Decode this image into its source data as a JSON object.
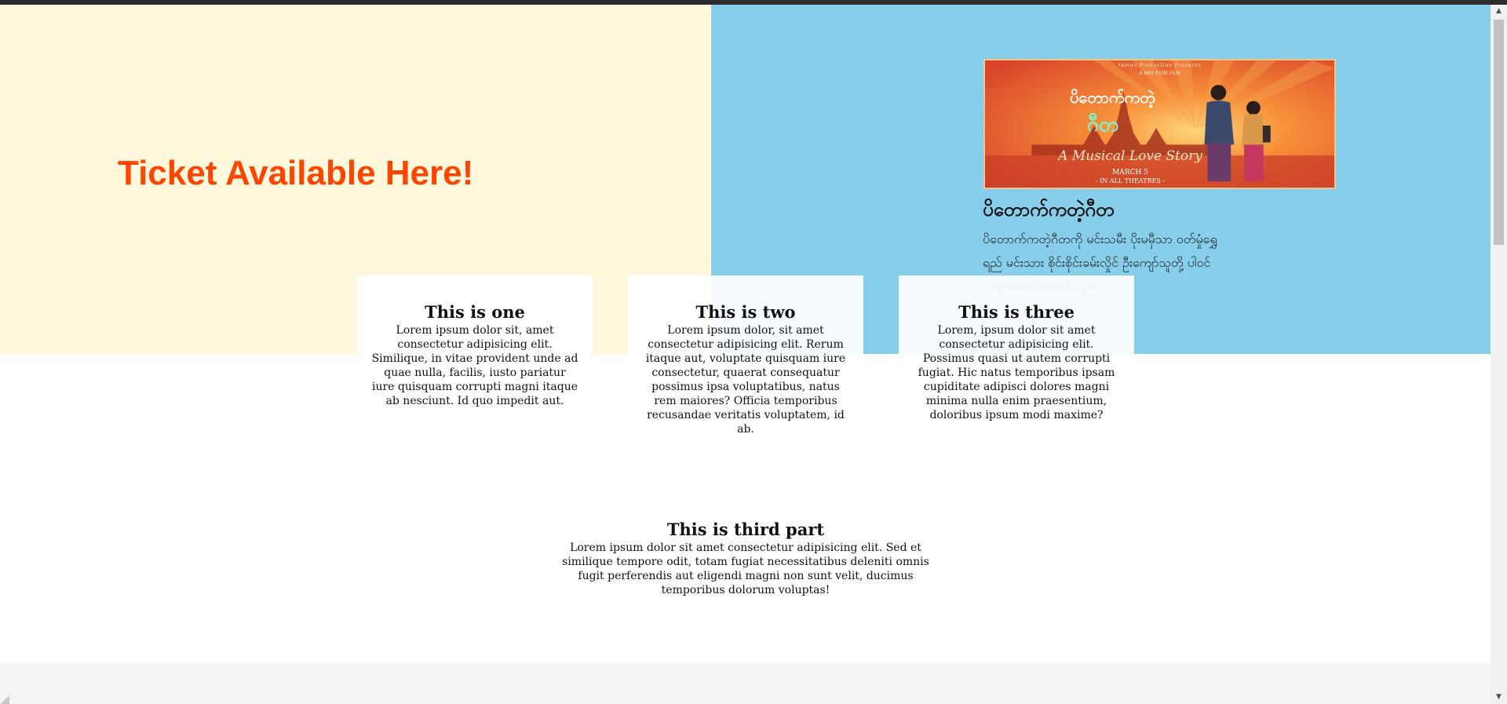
{
  "hero": {
    "title": "Ticket Available Here!"
  },
  "movie": {
    "poster": {
      "top_caption": "Yaman Production Presents",
      "director": "A MEE POSE FILM",
      "logo_line_1": "ပိတောက်ကတဲ့",
      "logo_line_2": "ဂီတ",
      "tagline": "A Musical Love Story",
      "date": "MARCH 5",
      "theatres": "- IN ALL THEATRES -"
    },
    "title": "ပိတောက်ကတဲ့ဂီတ",
    "description": "ပိတောက်ကတဲ့ဂီတကို မင်းသမီး ပိုးမမှီသာ ဝတ်မှုံရွှေရည် မင်းသား စိုင်းစိုင်းခမ်းလှိုင် ဦးကျော်သူတို့ ပါဝင်သရုပ်ဆောင်ထားပါသည်။"
  },
  "cards": [
    {
      "title": "This is one",
      "text": "Lorem ipsum dolor sit, amet consectetur adipisicing elit. Similique, in vitae provident unde ad quae nulla, facilis, iusto pariatur iure quisquam corrupti magni itaque ab nesciunt. Id quo impedit aut."
    },
    {
      "title": "This is two",
      "text": "Lorem ipsum dolor, sit amet consectetur adipisicing elit. Rerum itaque aut, voluptate quisquam iure consectetur, quaerat consequatur possimus ipsa voluptatibus, natus rem maiores? Officia temporibus recusandae veritatis voluptatem, id ab."
    },
    {
      "title": "This is three",
      "text": "Lorem, ipsum dolor sit amet consectetur adipisicing elit. Possimus quasi ut autem corrupti fugiat. Hic natus temporibus ipsam cupiditate adipisci dolores magni minima nulla enim praesentium, doloribus ipsum modi maxime?"
    }
  ],
  "third": {
    "title": "This is third part",
    "text": "Lorem ipsum dolor sit amet consectetur adipisicing elit. Sed et similique tempore odit, totam fugiat necessitatibus deleniti omnis fugit perferendis aut eligendi magni non sunt velit, ducimus temporibus dolorum voluptas!"
  },
  "scrollbar": {
    "up_icon": "arrow-up-icon",
    "down_icon": "arrow-down-icon",
    "scroll_fraction": 0
  },
  "colors": {
    "hero_left_bg": "#fff8dc",
    "hero_right_bg": "#87ceeb",
    "accent": "#ff4500"
  }
}
